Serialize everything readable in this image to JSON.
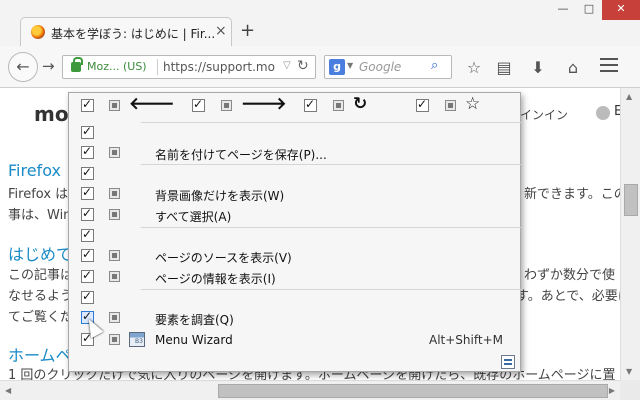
{
  "tab": {
    "title": "基本を学ぼう: はじめに | Fir...",
    "close": "×",
    "new_tab": "+"
  },
  "window": {
    "minimize": "—",
    "maximize": "□",
    "close": "✕"
  },
  "navbar": {
    "back": "←",
    "forward": "→",
    "site_identity": "Moz... (US)",
    "url": "https://support.mo",
    "reload": "↻",
    "search_engine": "g",
    "search_placeholder": "Google"
  },
  "page": {
    "logo": "moz",
    "signin": "インイン",
    "lang_indicator": "E",
    "h1": "Firefox",
    "line1a": "Firefox は",
    "line1b": "新できます。この",
    "line2": "事は、Win",
    "h2": "はじめて",
    "line3a": "この記事は",
    "line3b": "わずか数分で使",
    "line4a": "なせるよう",
    "line4b": "す。あとで、必要に",
    "line5": "てご覧くだ",
    "h3": "ホームペ",
    "line6": "1 回のクリックだけで気に入りのページを開けます。ホームページを開けたら、既存のホームページに置"
  },
  "context_menu": {
    "nav_row": {
      "back_glyph": "🡐",
      "forward_glyph": "🡒",
      "reload_glyph": "↻",
      "bookmark_glyph": "☆"
    },
    "items": [
      {
        "label": "名前を付けてページを保存(P)..."
      },
      {
        "label": "背景画像だけを表示(W)"
      },
      {
        "label": "すべて選択(A)"
      },
      {
        "label": "ページのソースを表示(V)"
      },
      {
        "label": "ページの情報を表示(I)"
      },
      {
        "label": "要素を調査(Q)"
      },
      {
        "label": "Menu Wizard",
        "shortcut": "Alt+Shift+M"
      }
    ]
  }
}
